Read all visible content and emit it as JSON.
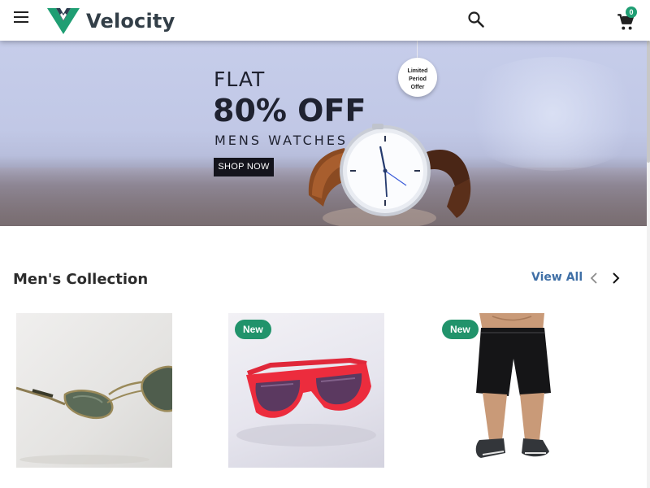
{
  "header": {
    "brand": "Velocity",
    "cart_count": "0",
    "menu_icon": "hamburger-menu-icon",
    "search_icon": "search-icon",
    "cart_icon": "shopping-cart-icon",
    "accent_color": "#1f9e73"
  },
  "banner": {
    "line1": "FLAT",
    "line2": "80% OFF",
    "line3": "MENS WATCHES",
    "button_label": "SHOP NOW",
    "offer_tag": [
      "Limited",
      "Period",
      "Offer"
    ]
  },
  "collection": {
    "title": "Men's Collection",
    "view_all": "View All",
    "prev_icon": "chevron-left-icon",
    "next_icon": "chevron-right-icon",
    "products": [
      {
        "image": "aviator-sunglasses",
        "badge": ""
      },
      {
        "image": "red-sunglasses",
        "badge": "New"
      },
      {
        "image": "black-shorts",
        "badge": "New"
      }
    ],
    "badge_color": "#21936b"
  }
}
